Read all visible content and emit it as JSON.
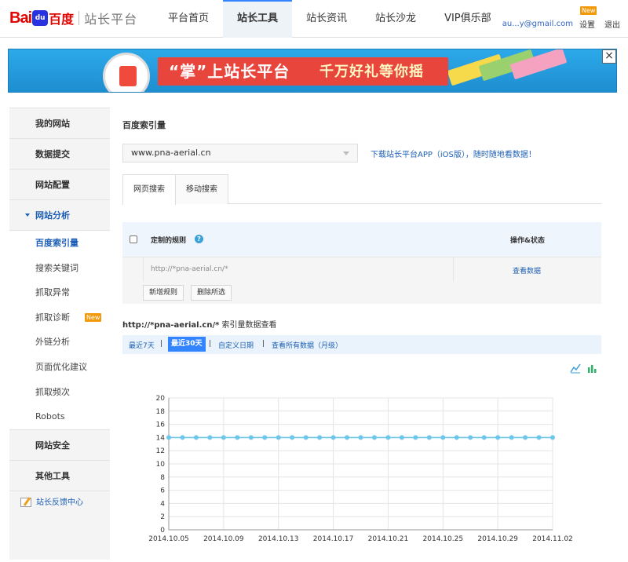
{
  "logo": {
    "bai": "Bai",
    "du": "du",
    "baidu_cn": "百度",
    "platform": "站长平台"
  },
  "nav": {
    "items": [
      {
        "label": "平台首页"
      },
      {
        "label": "站长工具"
      },
      {
        "label": "站长资讯"
      },
      {
        "label": "站长沙龙"
      },
      {
        "label": "VIP俱乐部"
      }
    ],
    "active_index": 1
  },
  "user": {
    "email": "au...y@gmail.com",
    "settings": "设置",
    "settings_badge": "New",
    "logout": "退出"
  },
  "banner": {
    "text1": "“掌”上站长平台",
    "text2": "千万好礼等你摇",
    "close": "×"
  },
  "sidebar": {
    "items": [
      {
        "label": "我的网站"
      },
      {
        "label": "数据提交"
      },
      {
        "label": "网站配置"
      }
    ],
    "expanded": {
      "label": "网站分析",
      "subitems": [
        {
          "label": "百度索引量"
        },
        {
          "label": "搜索关键词"
        },
        {
          "label": "抓取异常"
        },
        {
          "label": "抓取诊断",
          "badge": "New"
        },
        {
          "label": "外链分析"
        },
        {
          "label": "页面优化建议"
        },
        {
          "label": "抓取频次"
        },
        {
          "label": "Robots"
        }
      ]
    },
    "bottom_items": [
      {
        "label": "网站安全"
      },
      {
        "label": "其他工具"
      }
    ],
    "feedback": "站长反馈中心"
  },
  "main": {
    "title": "百度索引量",
    "site_select": "www.pna-aerial.cn",
    "app_link": "下载站长平台APP（iOS版），随时随地看数据！",
    "tabs": [
      {
        "label": "网页搜索"
      },
      {
        "label": "移动搜索"
      }
    ],
    "rules": {
      "col_rule": "定制的规则",
      "col_action": "操作&状态",
      "rows": [
        {
          "rule": "http://*pna-aerial.cn/*",
          "action": "查看数据"
        }
      ],
      "add_button": "新增规则",
      "delete_button": "删除所选"
    },
    "stat_title_rule": "http://*pna-aerial.cn/*",
    "stat_title_suffix": "索引量数据查看",
    "ranges": [
      {
        "label": "最近7天"
      },
      {
        "label": "最近30天"
      },
      {
        "label": "自定义日期"
      },
      {
        "label": "查看所有数据（月级）"
      }
    ],
    "range_active_index": 1,
    "range_separator": "|"
  },
  "colors": {
    "accent": "#3385ff",
    "link": "#1d5fb5",
    "series": "#6ec6ea",
    "brand_red": "#e10602"
  },
  "chart_data": {
    "type": "line",
    "x": [
      "2014.10.05",
      "2014.10.06",
      "2014.10.07",
      "2014.10.08",
      "2014.10.09",
      "2014.10.10",
      "2014.10.11",
      "2014.10.12",
      "2014.10.13",
      "2014.10.14",
      "2014.10.15",
      "2014.10.16",
      "2014.10.17",
      "2014.10.18",
      "2014.10.19",
      "2014.10.20",
      "2014.10.21",
      "2014.10.22",
      "2014.10.23",
      "2014.10.24",
      "2014.10.25",
      "2014.10.26",
      "2014.10.27",
      "2014.10.28",
      "2014.10.29",
      "2014.10.30",
      "2014.10.31",
      "2014.11.01",
      "2014.11.02"
    ],
    "x_tick_labels": [
      "2014.10.05",
      "2014.10.09",
      "2014.10.13",
      "2014.10.17",
      "2014.10.21",
      "2014.10.25",
      "2014.10.29",
      "2014.11.02"
    ],
    "series": [
      {
        "values": [
          14,
          14,
          14,
          14,
          14,
          14,
          14,
          14,
          14,
          14,
          14,
          14,
          14,
          14,
          14,
          14,
          14,
          14,
          14,
          14,
          14,
          14,
          14,
          14,
          14,
          14,
          14,
          14,
          14
        ]
      }
    ],
    "ylim": [
      0,
      20
    ],
    "y_ticks": [
      0,
      2,
      4,
      6,
      8,
      10,
      12,
      14,
      16,
      18,
      20
    ],
    "grid": true,
    "title": "",
    "xlabel": "",
    "ylabel": ""
  }
}
